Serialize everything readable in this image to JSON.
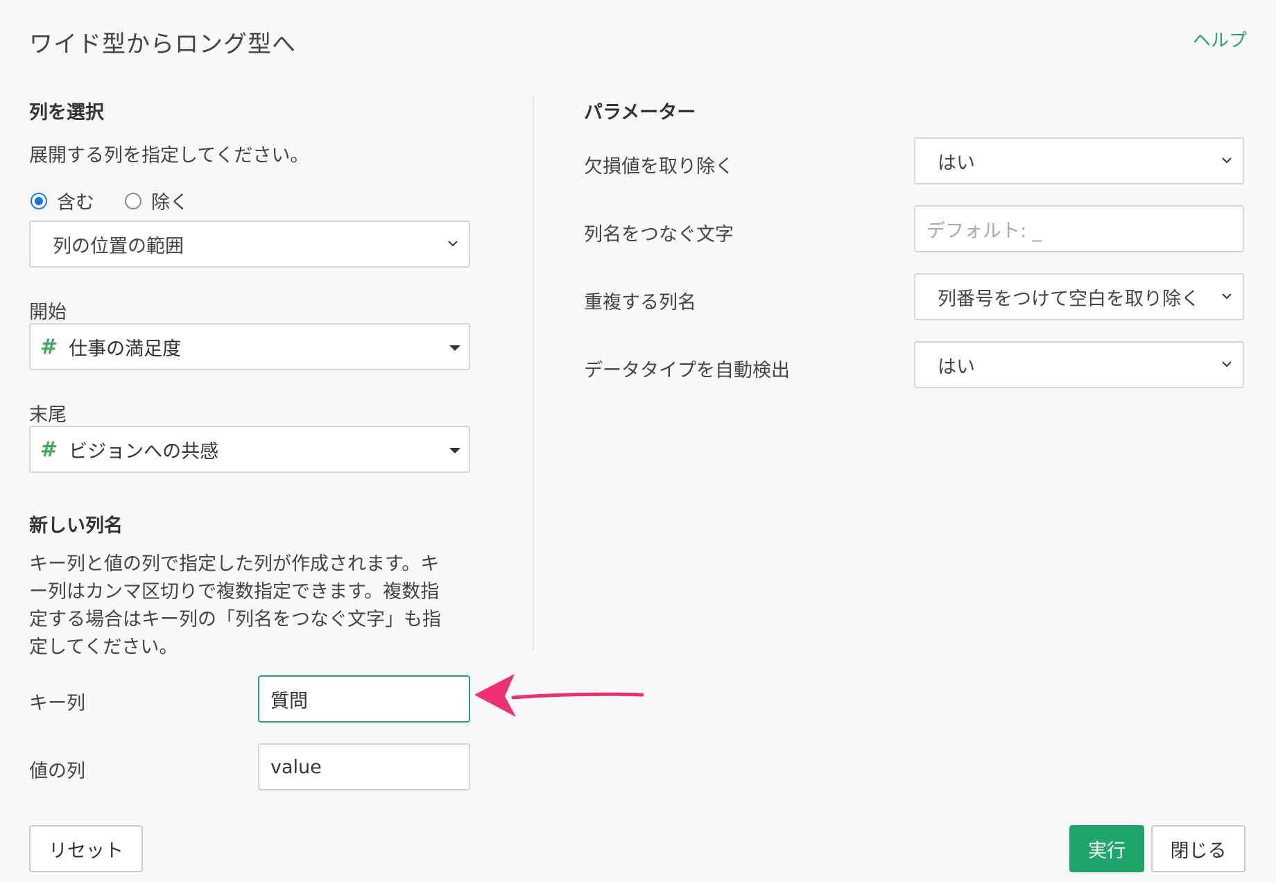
{
  "dialog": {
    "title": "ワイド型からロング型へ",
    "help_label": "ヘルプ"
  },
  "columns": {
    "heading": "列を選択",
    "description": "展開する列を指定してください。",
    "include_label": "含む",
    "exclude_label": "除く",
    "selected_mode": "include",
    "range_select_value": "列の位置の範囲",
    "start_label": "開始",
    "start_value": "仕事の満足度",
    "start_icon": "hash-icon",
    "end_label": "末尾",
    "end_value": "ビジョンへの共感",
    "end_icon": "hash-icon"
  },
  "new_columns": {
    "heading": "新しい列名",
    "description_lines": [
      "キー列と値の列で指定した列が作成されます。キ",
      "ー列はカンマ区切りで複数指定できます。複数指",
      "定する場合はキー列の「列名をつなぐ文字」も指",
      "定してください。"
    ],
    "key_label": "キー列",
    "key_value": "質問",
    "value_label": "値の列",
    "value_value": "value"
  },
  "parameters": {
    "heading": "パラメーター",
    "remove_na_label": "欠損値を取り除く",
    "remove_na_value": "はい",
    "separator_label": "列名をつなぐ文字",
    "separator_placeholder": "デフォルト: _",
    "duplicate_label": "重複する列名",
    "duplicate_value": "列番号をつけて空白を取り除く",
    "detect_type_label": "データタイプを自動検出",
    "detect_type_value": "はい"
  },
  "footer": {
    "reset_label": "リセット",
    "run_label": "実行",
    "close_label": "閉じる"
  },
  "colors": {
    "accent": "#1ea76b",
    "annotation_arrow": "#f0306e"
  }
}
